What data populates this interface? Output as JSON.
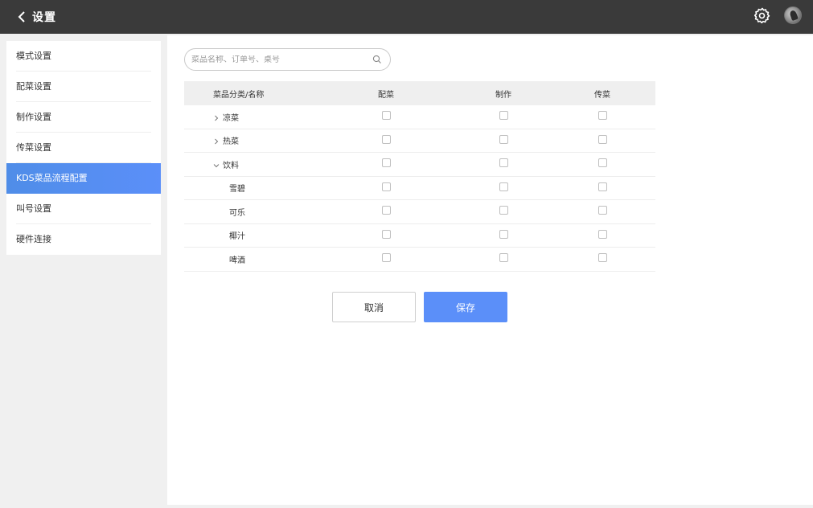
{
  "header": {
    "title": "设置"
  },
  "sidebar": {
    "items": [
      {
        "label": "模式设置"
      },
      {
        "label": "配菜设置"
      },
      {
        "label": "制作设置"
      },
      {
        "label": "传菜设置"
      },
      {
        "label": "KDS菜品流程配置",
        "active": true
      },
      {
        "label": "叫号设置"
      },
      {
        "label": "硬件连接"
      }
    ]
  },
  "search": {
    "placeholder": "菜品名称、订单号、桌号"
  },
  "table": {
    "headers": [
      "菜品分类/名称",
      "配菜",
      "制作",
      "传菜"
    ],
    "rows": [
      {
        "name": "凉菜",
        "type": "category",
        "state": "collapsed",
        "peicai": false,
        "zhizuo": false,
        "chuancai": false
      },
      {
        "name": "热菜",
        "type": "category",
        "state": "collapsed",
        "peicai": false,
        "zhizuo": false,
        "chuancai": false
      },
      {
        "name": "饮料",
        "type": "category",
        "state": "expanded",
        "peicai": false,
        "zhizuo": false,
        "chuancai": false
      },
      {
        "name": "雪碧",
        "type": "item",
        "peicai": false,
        "zhizuo": false,
        "chuancai": false
      },
      {
        "name": "可乐",
        "type": "item",
        "peicai": false,
        "zhizuo": false,
        "chuancai": false
      },
      {
        "name": "椰汁",
        "type": "item",
        "peicai": false,
        "zhizuo": false,
        "chuancai": false
      },
      {
        "name": "啤酒",
        "type": "item",
        "peicai": false,
        "zhizuo": false,
        "chuancai": false
      }
    ]
  },
  "buttons": {
    "cancel": "取消",
    "save": "保存"
  },
  "colors": {
    "accent": "#5b8ff9",
    "header_bg": "#3a3a3a"
  },
  "icons": {
    "back": "chevron-left-icon",
    "settings": "gear-icon",
    "search": "search-icon"
  }
}
